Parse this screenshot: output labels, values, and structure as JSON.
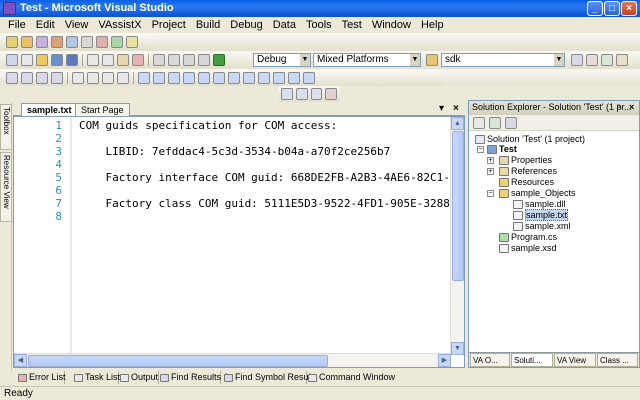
{
  "window": {
    "title": "Test - Microsoft Visual Studio",
    "minimize": "_",
    "maximize": "□",
    "close": "×"
  },
  "menu": [
    "File",
    "Edit",
    "View",
    "VAssistX",
    "Project",
    "Build",
    "Debug",
    "Data",
    "Tools",
    "Test",
    "Window",
    "Help"
  ],
  "toolbar": {
    "configuration": "Debug",
    "platform": "Mixed Platforms",
    "find_value": "sdk"
  },
  "left_strip": {
    "toolbox": "Toolbox",
    "resource_view": "Resource View"
  },
  "document_tabs": {
    "active": "sample.txt",
    "other": "Start Page",
    "dropdown": "▾",
    "close": "×"
  },
  "editor": {
    "line_numbers": [
      "1",
      "2",
      "3",
      "4",
      "5",
      "6",
      "7",
      "8"
    ],
    "lines": [
      "COM guids specification for COM access:",
      "",
      "    LIBID: 7efddac4-5c3d-3534-b04a-a70f2ce256b7",
      "",
      "    Factory interface COM guid: 668DE2FB-A2B3-4AE6-82C1-",
      "",
      "    Factory class COM guid: 5111E5D3-9522-4FD1-905E-3288",
      ""
    ]
  },
  "solution_explorer": {
    "title": "Solution Explorer - Solution 'Test' (1 pr...",
    "pin": "ᵖ",
    "close": "×",
    "tree": {
      "solution": "Solution 'Test' (1 project)",
      "project": "Test",
      "properties": "Properties",
      "references": "References",
      "resources": "Resources",
      "sample_objects": "sample_Objects",
      "sample_dll": "sample.dll",
      "sample_txt": "sample.txt",
      "sample_xml": "sample.xml",
      "program_cs": "Program.cs",
      "sample_xsd": "sample.xsd"
    },
    "tabs": [
      "VA O...",
      "Soluti...",
      "VA View",
      "Class ..."
    ]
  },
  "bottom_tabs": [
    "Error List",
    "Task List",
    "Output",
    "Find Results 1",
    "Find Symbol Results",
    "Command Window"
  ],
  "status": "Ready"
}
